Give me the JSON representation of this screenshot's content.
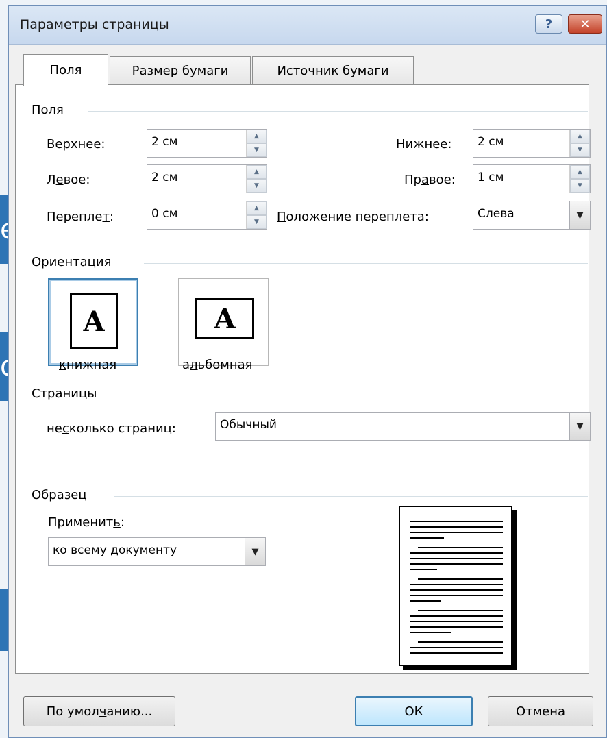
{
  "window": {
    "title": "Параметры страницы",
    "help_glyph": "?",
    "close_glyph": "✕"
  },
  "tabs": [
    {
      "label": "Поля",
      "active": true
    },
    {
      "label": "Размер бумаги",
      "active": false
    },
    {
      "label": "Источник бумаги",
      "active": false
    }
  ],
  "margins": {
    "group_label": "Поля",
    "top": {
      "label_pre": "Вер",
      "label_acc": "х",
      "label_post": "нее:",
      "value": "2 см"
    },
    "bottom": {
      "label_pre": "",
      "label_acc": "Н",
      "label_post": "ижнее:",
      "value": "2 см"
    },
    "left": {
      "label_pre": "Л",
      "label_acc": "е",
      "label_post": "вое:",
      "value": "2 см"
    },
    "right": {
      "label_pre": "Пр",
      "label_acc": "а",
      "label_post": "вое:",
      "value": "1 см"
    },
    "gutter": {
      "label_pre": "Перепле",
      "label_acc": "т",
      "label_post": ":",
      "value": "0 см"
    },
    "gutter_pos": {
      "label_pre": "",
      "label_acc": "П",
      "label_post": "оложение переплета:",
      "value": "Слева"
    }
  },
  "orientation": {
    "group_label": "Ориентация",
    "portrait": {
      "label_pre": "",
      "label_acc": "к",
      "label_post": "нижная",
      "glyph": "A",
      "selected": true
    },
    "landscape": {
      "label_pre": "а",
      "label_acc": "л",
      "label_post": "ьбомная",
      "glyph": "A",
      "selected": false
    }
  },
  "pages": {
    "group_label": "Страницы",
    "label_pre": "не",
    "label_acc": "с",
    "label_post": "колько страниц:",
    "value": "Обычный"
  },
  "sample": {
    "group_label": "Образец",
    "apply_pre": "Применит",
    "apply_acc": "ь",
    "apply_post": ":",
    "apply_value": "ко всему документу"
  },
  "buttons": {
    "default_pre": "По умол",
    "default_acc": "ч",
    "default_post": "анию...",
    "ok": "ОК",
    "cancel": "Отмена"
  },
  "background_fragments": [
    "e",
    "o"
  ],
  "colors": {
    "accent": "#3c7fb1",
    "titlebar": "#c7d8ee",
    "close": "#c4432a",
    "background_slide": "#2e74b5"
  }
}
